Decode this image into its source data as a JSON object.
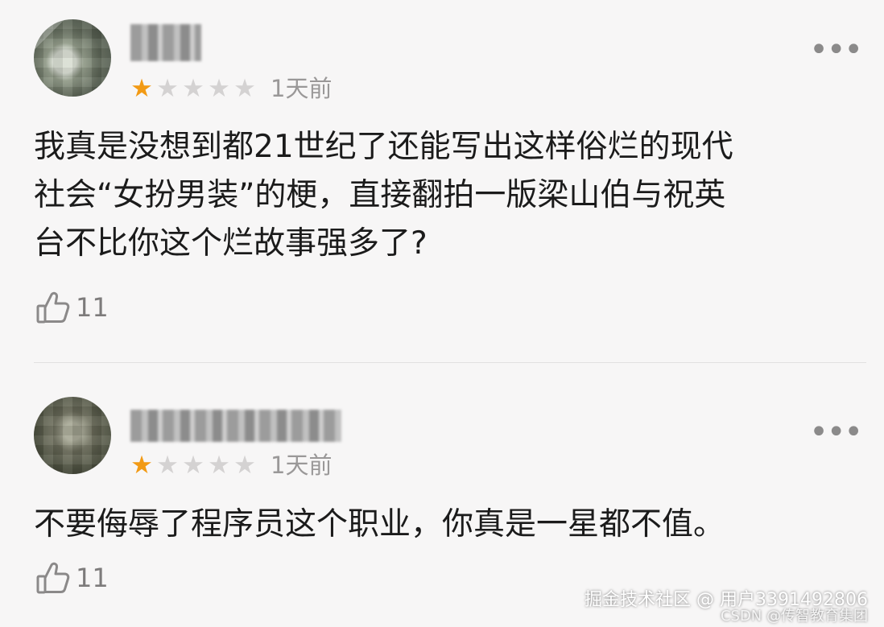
{
  "comments": [
    {
      "rating": 1,
      "max_rating": 5,
      "time": "1天前",
      "text_lines": [
        "我真是没想到都21世纪了还能写出这样俗烂的现代",
        "社会“女扮男装”的梗，直接翻拍一版梁山伯与祝英",
        "台不比你这个烂故事强多了?"
      ],
      "likes": "11",
      "more_icon": "more-dots-icon",
      "like_icon": "thumbs-up-icon"
    },
    {
      "rating": 1,
      "max_rating": 5,
      "time": "1天前",
      "text_lines": [
        "不要侮辱了程序员这个职业，你真是一星都不值。"
      ],
      "likes": "11",
      "more_icon": "more-dots-icon",
      "like_icon": "thumbs-up-icon"
    }
  ],
  "watermark": {
    "line1": "掘金技术社区 @ 用户3391492806",
    "line2": "CSDN @传智教育集团"
  },
  "colors": {
    "star_filled": "#f29a14",
    "star_empty": "#d4d2d2",
    "background": "#f7f6f6"
  }
}
